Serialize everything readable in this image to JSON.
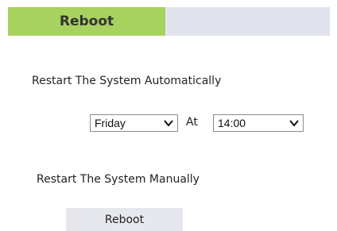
{
  "header": {
    "tab_label": "Reboot"
  },
  "auto_restart": {
    "label": "Restart The System Automatically",
    "day_value": "Friday",
    "at_label": "At",
    "time_value": "14:00"
  },
  "manual_restart": {
    "label": "Restart The System Manually",
    "button_label": "Reboot"
  },
  "icons": {
    "dropdown": "chevron-down-icon"
  },
  "colors": {
    "tab_active": "#a8d25f",
    "header_bar": "#e1e4ed",
    "button_bg": "#e6e8ee"
  }
}
